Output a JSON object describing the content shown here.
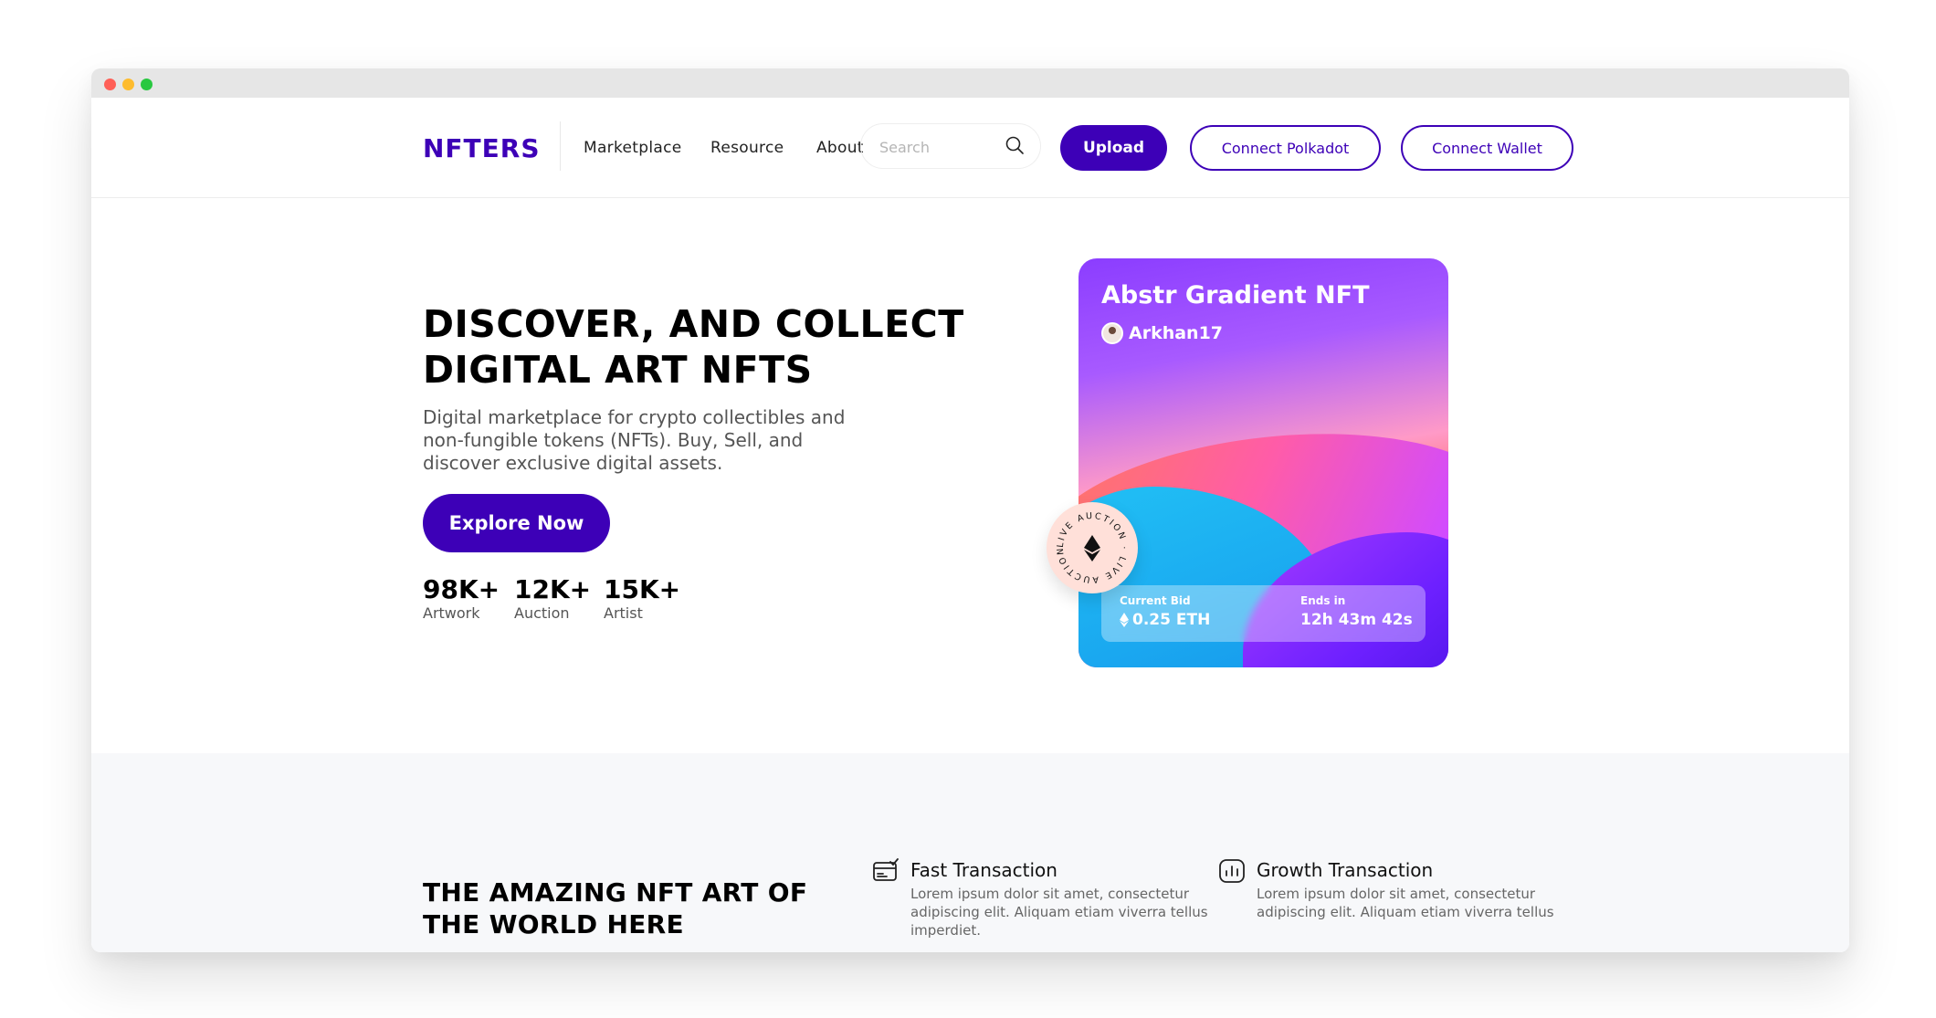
{
  "nav": {
    "logo": "NFTERS",
    "links": [
      "Marketplace",
      "Resource",
      "About"
    ],
    "search_placeholder": "Search",
    "upload_label": "Upload",
    "polkadot_label": "Connect Polkadot",
    "wallet_label": "Connect Wallet"
  },
  "hero": {
    "title_line1": "DISCOVER, AND COLLECT",
    "title_line2": "DIGITAL ART NFTS",
    "description": "Digital marketplace for crypto collectibles and non-fungible tokens (NFTs). Buy, Sell, and discover exclusive digital assets.",
    "cta_label": "Explore Now",
    "stats": [
      {
        "value": "98K+",
        "label": "Artwork"
      },
      {
        "value": "12K+",
        "label": "Auction"
      },
      {
        "value": "15K+",
        "label": "Artist"
      }
    ]
  },
  "nft_card": {
    "title": "Abstr Gradient NFT",
    "author": "Arkhan17",
    "current_bid_label": "Current Bid",
    "current_bid_value": "0.25 ETH",
    "ends_in_label": "Ends in",
    "ends_in_value": "12h 43m 42s",
    "badge_text": "LIVE AUCTION · LIVE AUCTION ·"
  },
  "section2": {
    "title": "THE AMAZING NFT ART OF THE WORLD HERE",
    "features": [
      {
        "icon": "card-check-icon",
        "title": "Fast Transaction",
        "description": "Lorem ipsum dolor sit amet, consectetur adipiscing elit. Aliquam etiam viverra tellus imperdiet."
      },
      {
        "icon": "bar-chart-icon",
        "title": "Growth Transaction",
        "description": "Lorem ipsum dolor sit amet, consectetur adipiscing elit. Aliquam etiam viverra tellus"
      }
    ]
  },
  "colors": {
    "brand": "#3d00b7"
  }
}
